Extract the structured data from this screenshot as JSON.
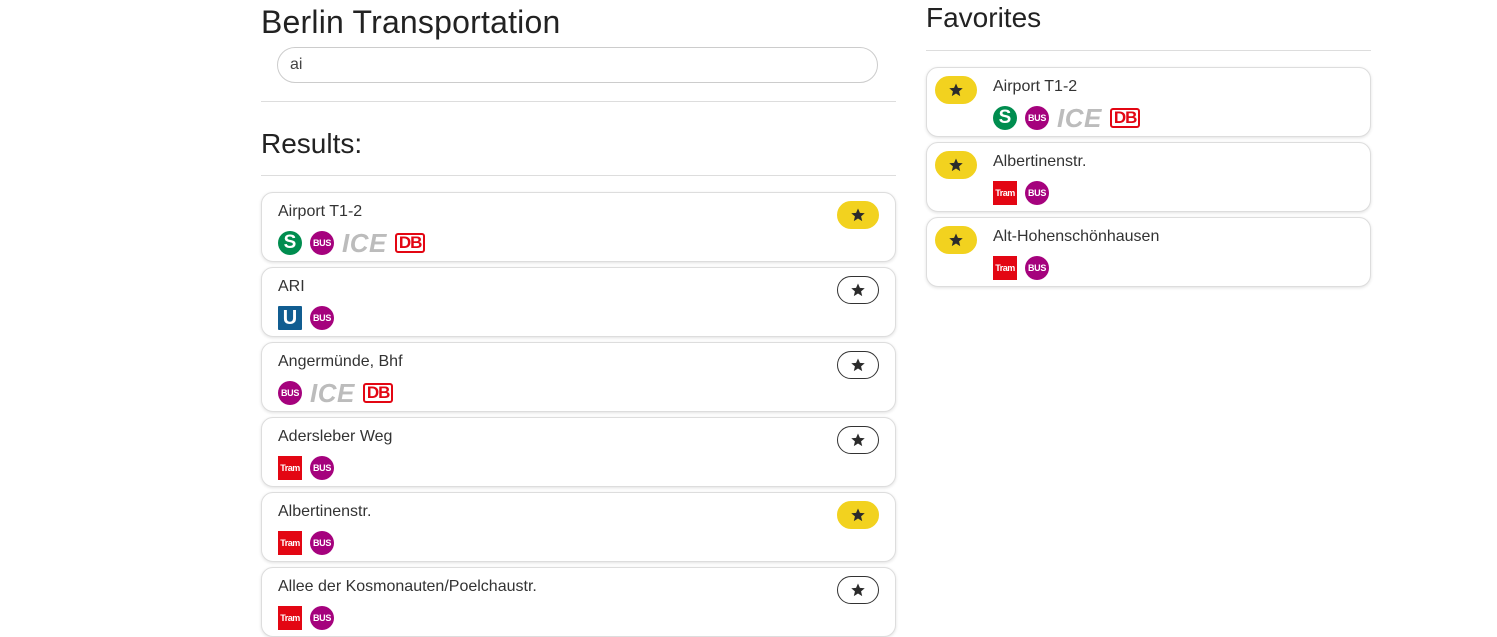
{
  "app": {
    "title": "Berlin Transportation"
  },
  "search": {
    "value": "ai"
  },
  "results": {
    "heading": "Results:",
    "items": [
      {
        "name": "Airport T1-2",
        "favorite": true,
        "icons": [
          "S",
          "BUS",
          "ICE",
          "DB"
        ]
      },
      {
        "name": "ARI",
        "favorite": false,
        "icons": [
          "U",
          "BUS"
        ]
      },
      {
        "name": "Angermünde, Bhf",
        "favorite": false,
        "icons": [
          "BUS",
          "ICE",
          "DB"
        ]
      },
      {
        "name": "Adersleber Weg",
        "favorite": false,
        "icons": [
          "Tram",
          "BUS"
        ]
      },
      {
        "name": "Albertinenstr.",
        "favorite": true,
        "icons": [
          "Tram",
          "BUS"
        ]
      },
      {
        "name": "Allee der Kosmonauten/Poelchaustr.",
        "favorite": false,
        "icons": [
          "Tram",
          "BUS"
        ]
      }
    ]
  },
  "favorites": {
    "heading": "Favorites",
    "items": [
      {
        "name": "Airport T1-2",
        "icons": [
          "S",
          "BUS",
          "ICE",
          "DB"
        ]
      },
      {
        "name": "Albertinenstr.",
        "icons": [
          "Tram",
          "BUS"
        ]
      },
      {
        "name": "Alt-Hohenschönhausen",
        "icons": [
          "Tram",
          "BUS"
        ]
      }
    ]
  },
  "colors": {
    "favorite_on": "#f2d21f",
    "s_bahn": "#008d4f",
    "bus": "#a5027d",
    "u_bahn": "#115d91",
    "tram_db": "#e30613",
    "ice": "#bcbcbc"
  }
}
